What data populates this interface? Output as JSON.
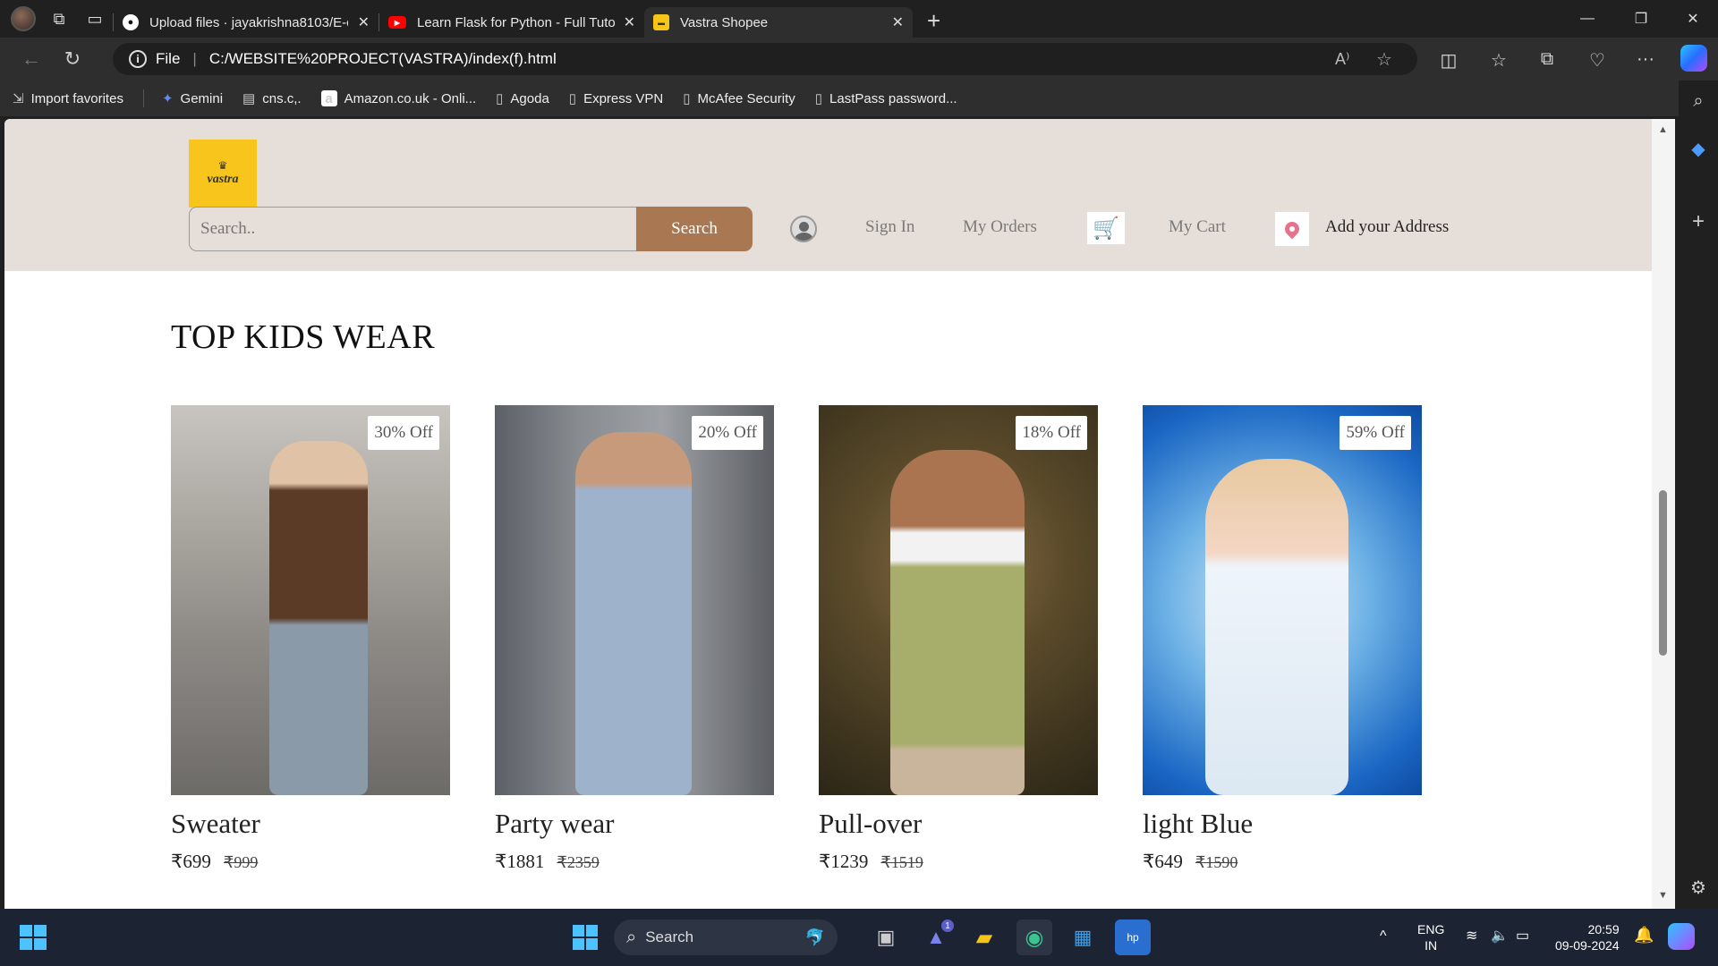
{
  "browser": {
    "tabs": [
      {
        "title": "Upload files · jayakrishna8103/E-c",
        "favicon": "github-icon"
      },
      {
        "title": "Learn Flask for Python - Full Tutor",
        "favicon": "youtube-icon"
      },
      {
        "title": "Vastra Shopee",
        "favicon": "vastra-icon",
        "active": true
      }
    ],
    "address": {
      "scheme_label": "File",
      "url": "C:/WEBSITE%20PROJECT(VASTRA)/index(f).html"
    },
    "favorites": [
      {
        "label": "Import favorites",
        "icon": "import-icon"
      },
      {
        "label": "Gemini",
        "icon": "gemini-icon"
      },
      {
        "label": "cns.c,.",
        "icon": "folder-icon"
      },
      {
        "label": "Amazon.co.uk - Onli...",
        "icon": "amazon-icon"
      },
      {
        "label": "Agoda",
        "icon": "page-icon"
      },
      {
        "label": "Express VPN",
        "icon": "page-icon"
      },
      {
        "label": "McAfee Security",
        "icon": "page-icon"
      },
      {
        "label": "LastPass password...",
        "icon": "page-icon"
      }
    ]
  },
  "site": {
    "logo_text": "vastra",
    "search": {
      "placeholder": "Search..",
      "button_label": "Search"
    },
    "nav": {
      "sign_in": "Sign In",
      "my_orders": "My Orders",
      "my_cart": "My Cart",
      "address": "Add your Address"
    },
    "colors": {
      "header_bg": "#e6dfd9",
      "accent": "#a97853",
      "logo_bg": "#f8c51c"
    },
    "section_title": "TOP KIDS WEAR",
    "products": [
      {
        "name": "Sweater",
        "price": "₹699",
        "old_price": "₹999",
        "discount": "30% Off"
      },
      {
        "name": "Party wear",
        "price": "₹1881",
        "old_price": "₹2359",
        "discount": "20% Off"
      },
      {
        "name": "Pull-over",
        "price": "₹1239",
        "old_price": "₹1519",
        "discount": "18% Off"
      },
      {
        "name": "light Blue",
        "price": "₹649",
        "old_price": "₹1590",
        "discount": "59% Off"
      }
    ]
  },
  "taskbar": {
    "search_label": "Search",
    "language": "ENG",
    "region": "IN",
    "time": "20:59",
    "date": "09-09-2024",
    "teams_badge": "1"
  }
}
